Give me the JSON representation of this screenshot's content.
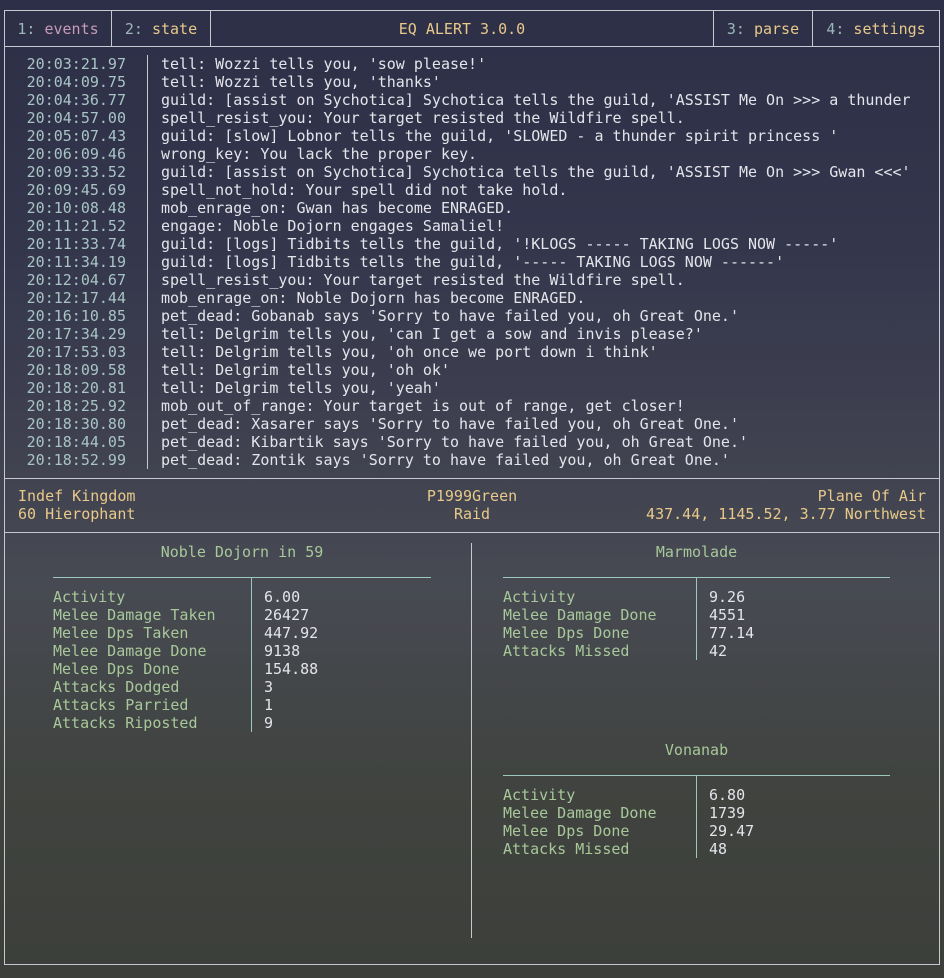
{
  "tabs": [
    {
      "num": "1:",
      "label": "events"
    },
    {
      "num": "2:",
      "label": "state"
    },
    {
      "num": "3:",
      "label": "parse"
    },
    {
      "num": "4:",
      "label": "settings"
    }
  ],
  "title": "EQ ALERT 3.0.0",
  "events": [
    [
      "20:03:21.97",
      "tell: Wozzi tells you, 'sow please!'"
    ],
    [
      "20:04:09.75",
      "tell: Wozzi tells you, 'thanks'"
    ],
    [
      "20:04:36.77",
      "guild: [assist on Sychotica] Sychotica tells the guild, 'ASSIST Me On >>> a thunder"
    ],
    [
      "20:04:57.00",
      "spell_resist_you: Your target resisted the Wildfire spell."
    ],
    [
      "20:05:07.43",
      "guild: [slow] Lobnor tells the guild, 'SLOWED - a thunder spirit princess '"
    ],
    [
      "20:06:09.46",
      "wrong_key: You lack the proper key."
    ],
    [
      "20:09:33.52",
      "guild: [assist on Sychotica] Sychotica tells the guild, 'ASSIST Me On >>> Gwan <<<'"
    ],
    [
      "20:09:45.69",
      "spell_not_hold: Your spell did not take hold."
    ],
    [
      "20:10:08.48",
      "mob_enrage_on: Gwan has become ENRAGED."
    ],
    [
      "20:11:21.52",
      "engage: Noble Dojorn engages Samaliel!"
    ],
    [
      "20:11:33.74",
      "guild: [logs] Tidbits tells the guild, '!KLOGS ----- TAKING LOGS NOW -----'"
    ],
    [
      "20:11:34.19",
      "guild: [logs] Tidbits tells the guild, '----- TAKING LOGS NOW ------'"
    ],
    [
      "20:12:04.67",
      "spell_resist_you: Your target resisted the Wildfire spell."
    ],
    [
      "20:12:17.44",
      "mob_enrage_on: Noble Dojorn has become ENRAGED."
    ],
    [
      "20:16:10.85",
      "pet_dead: Gobanab says 'Sorry to have failed you, oh Great One.'"
    ],
    [
      "20:17:34.29",
      "tell: Delgrim tells you, 'can I get a sow and invis please?'"
    ],
    [
      "20:17:53.03",
      "tell: Delgrim tells you, 'oh once we port down i think'"
    ],
    [
      "20:18:09.58",
      "tell: Delgrim tells you, 'oh ok'"
    ],
    [
      "20:18:20.81",
      "tell: Delgrim tells you, 'yeah'"
    ],
    [
      "20:18:25.92",
      "mob_out_of_range: Your target is out of range, get closer!"
    ],
    [
      "20:18:30.80",
      "pet_dead: Xasarer says 'Sorry to have failed you, oh Great One.'"
    ],
    [
      "20:18:44.05",
      "pet_dead: Kibartik says 'Sorry to have failed you, oh Great One.'"
    ],
    [
      "20:18:52.99",
      "pet_dead: Zontik says 'Sorry to have failed you, oh Great One.'"
    ]
  ],
  "info": {
    "guild": "Indef Kingdom",
    "server": "P1999Green",
    "zone": "Plane Of Air",
    "class": "60 Hierophant",
    "group": "Raid",
    "loc": "437.44, 1145.52, 3.77 Northwest"
  },
  "panels": [
    {
      "title": "Noble Dojorn in 59",
      "rows": [
        [
          "Activity",
          "6.00"
        ],
        [
          "Melee Damage Taken",
          "26427"
        ],
        [
          "Melee Dps Taken",
          "447.92"
        ],
        [
          "Melee Damage Done",
          "9138"
        ],
        [
          "Melee Dps Done",
          "154.88"
        ],
        [
          "Attacks Dodged",
          "3"
        ],
        [
          "Attacks Parried",
          "1"
        ],
        [
          "Attacks Riposted",
          "9"
        ]
      ]
    },
    {
      "title": "Marmolade",
      "rows": [
        [
          "Activity",
          "9.26"
        ],
        [
          "Melee Damage Done",
          "4551"
        ],
        [
          "Melee Dps Done",
          "77.14"
        ],
        [
          "Attacks Missed",
          "42"
        ]
      ]
    },
    {
      "title": "Vonanab",
      "rows": [
        [
          "Activity",
          "6.80"
        ],
        [
          "Melee Damage Done",
          "1739"
        ],
        [
          "Melee Dps Done",
          "29.47"
        ],
        [
          "Attacks Missed",
          "48"
        ]
      ]
    }
  ]
}
